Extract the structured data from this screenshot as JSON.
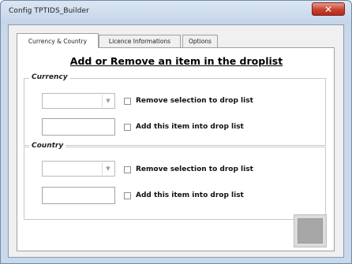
{
  "window": {
    "title": "Config TPTIDS_Builder",
    "close_glyph": "✕"
  },
  "tabs": [
    {
      "label": "Currency & Country",
      "active": true
    },
    {
      "label": "Licence Informations",
      "active": false
    },
    {
      "label": "Options",
      "active": false
    }
  ],
  "main": {
    "heading": "Add or Remove an item in the droplist",
    "currency": {
      "group_label": "Currency",
      "combo_value": "",
      "remove_label": "Remove selection to drop list",
      "add_value": "",
      "add_label": "Add this item into drop list"
    },
    "country": {
      "group_label": "Country",
      "combo_value": "",
      "remove_label": "Remove selection to drop list",
      "add_value": "",
      "add_label": "Add this item into drop list"
    }
  },
  "icons": {
    "combo_arrow": "▼"
  }
}
